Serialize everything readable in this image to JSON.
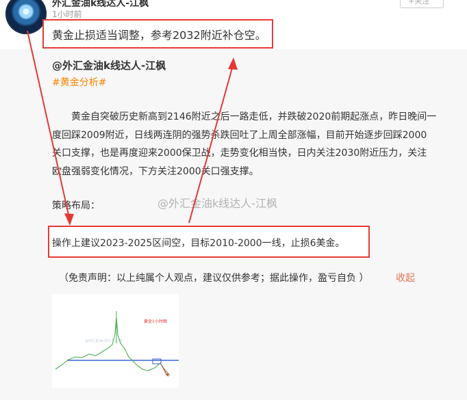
{
  "post": {
    "author_name": "外汇金油k线达人-江枫",
    "time": "1小时前",
    "follow_label": "+关注",
    "headline": "黄金止损适当调整，参考2032附近补仓空。",
    "mention": "@外汇金油k线达人-江枫",
    "hashtag": "#黄金分析#",
    "paragraph_lines": [
      "黄金自突破历史新高到2146附近之后一路走低，并跌破2020前期起涨点，昨日晚间一",
      "度回踩2009附近，日线两连阴的强势杀跌回吐了上周全部涨幅，目前开始逐步回踩2000",
      "关口支撑，也是再度迎来2000保卫战，走势变化相当快，日内关注2030附近压力，关注",
      "欧盘强弱变化情况，下方关注2000关口强支撑。"
    ],
    "strategy_label": "策略布局：",
    "watermark": "@外汇金油k线达人-江枫",
    "operation": "操作上建议2023-2025区间空，目标2010-2000一线，止损6美金。",
    "disclaimer": "（免责声明：以上纯属个人观点，建议仅供参考；据此操作，盈亏自负 ）",
    "collapse_label": "收起",
    "thumbnail": {
      "title": "黄金1小时图",
      "watermark": "@外汇金油k线达人-江枫"
    }
  },
  "colors": {
    "annotation_red": "#e53935",
    "hashtag_orange": "#ff8200",
    "collapse_orange": "#eb7350",
    "support_line_blue": "#3b63d8"
  },
  "icons": [
    "avatar-icon",
    "arrow-annotation"
  ]
}
